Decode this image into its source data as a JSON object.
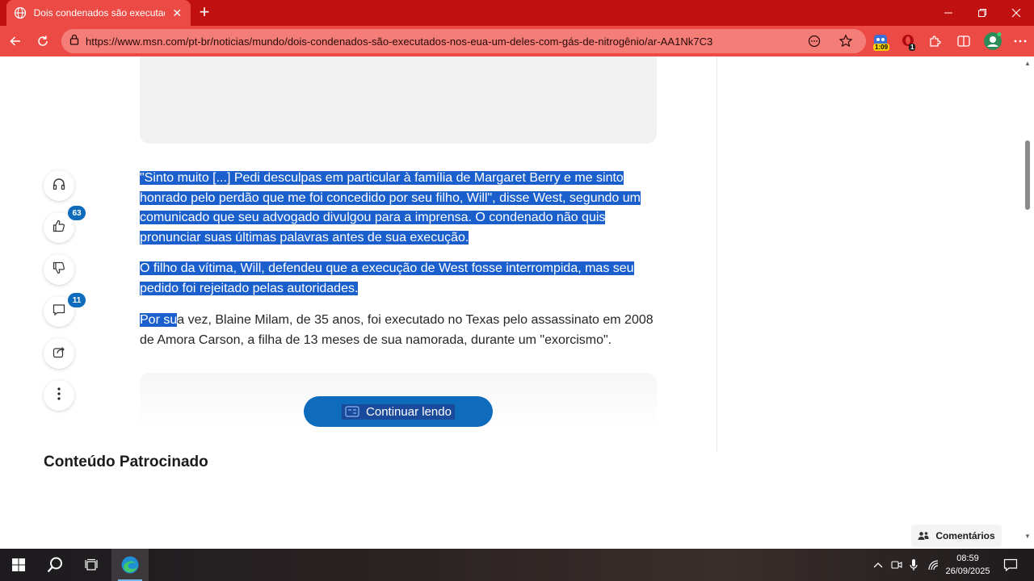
{
  "browser": {
    "tab_title": "Dois condenados são executados",
    "new_tab_symbol": "+",
    "url": "https://www.msn.com/pt-br/noticias/mundo/dois-condenados-são-executados-nos-eua-um-deles-com-gás-de-nitrogênio/ar-AA1Nk7C3",
    "extensions": [
      {
        "icon": "translate-extension-icon",
        "badge": "1:09"
      },
      {
        "icon": "opera-extension-icon",
        "badge": "1"
      },
      {
        "icon": "puzzle-extensions-icon"
      },
      {
        "icon": "split-screen-icon"
      },
      {
        "icon": "profile-avatar-icon"
      }
    ],
    "accent": "#c0100f"
  },
  "sidebar": {
    "like_count": "63",
    "comment_count": "11"
  },
  "article": {
    "p1": "\"Sinto muito [...] Pedi desculpas em particular à família de Margaret Berry e me sinto honrado pelo perdão que me foi concedido por seu filho, Will\", disse West, segundo um comunicado que seu advogado divulgou para a imprensa. O condenado não quis pronunciar suas últimas palavras antes de sua execução.",
    "p2": "O filho da vítima, Will, defendeu que a execução de West fosse interrompida, mas seu pedido foi rejeitado pelas autoridades.",
    "p3_highlighted": "Por su",
    "p3_rest": "a vez, Blaine Milam, de 35 anos, foi executado no Texas pelo assassinato em 2008 de Amora Carson, a filha de 13 meses de sua namorada, durante um \"exorcismo\".",
    "continue_label": "Continuar lendo",
    "selection_color": "#1a5fcb"
  },
  "sponsored_heading": "Conteúdo Patrocinado",
  "comments_button": "Comentários",
  "taskbar": {
    "time": "08:59",
    "date": "26/09/2025"
  }
}
